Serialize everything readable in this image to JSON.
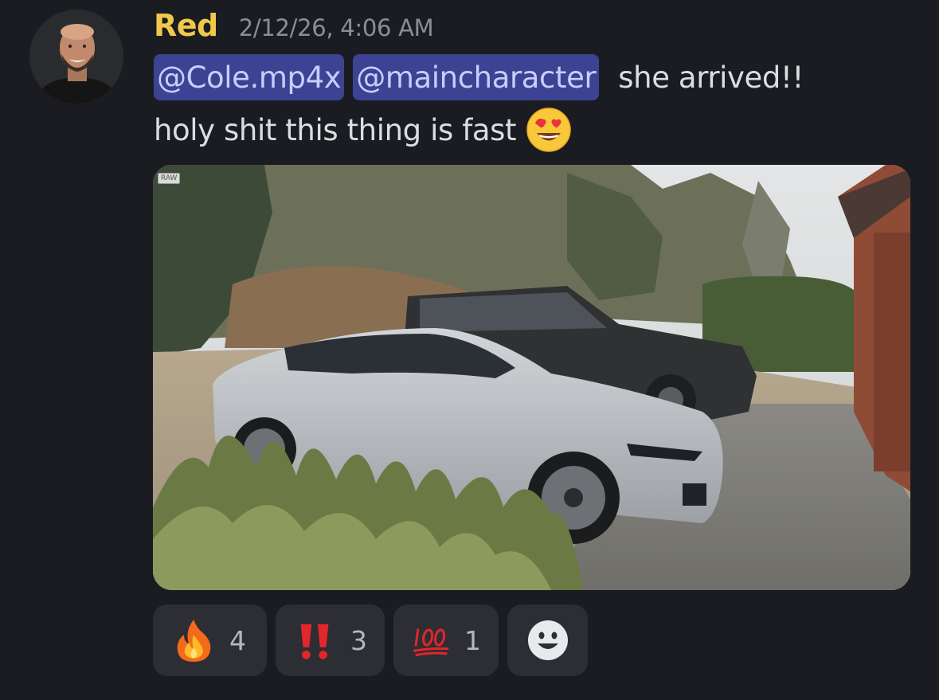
{
  "message": {
    "author": "Red",
    "timestamp": "2/12/26, 4:06 AM",
    "mentions": [
      "@Cole.mp4x",
      "@maincharacter"
    ],
    "text_line1": "she arrived!!",
    "text_line2": "holy shit this thing is fast",
    "inline_emoji": "smiling-face-with-heart-eyes-icon",
    "author_color": "#f0c84a",
    "mention_bg": "#3c4393"
  },
  "attachment": {
    "badge": "RAW",
    "icon": "photo-of-cars-image"
  },
  "reactions": [
    {
      "icon": "fire-icon",
      "count": "4"
    },
    {
      "icon": "double-exclamation-icon",
      "count": "3"
    },
    {
      "icon": "hundred-points-icon",
      "count": "1"
    }
  ],
  "add_reaction": {
    "icon": "add-reaction-smiley-icon"
  }
}
